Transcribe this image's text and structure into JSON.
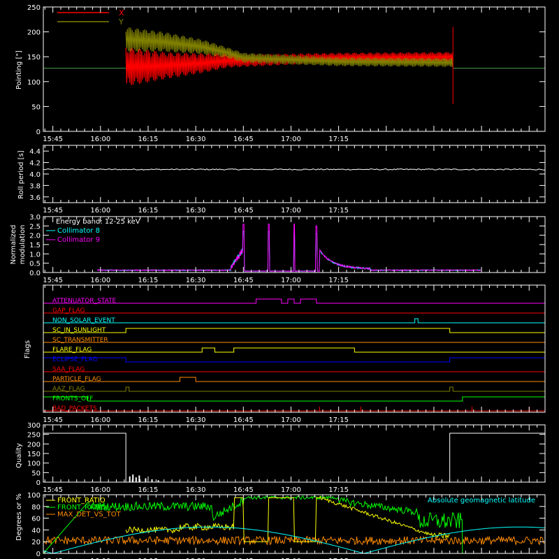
{
  "figure": {
    "background": "#000000",
    "foreground": "#ffffff"
  },
  "time_axis": {
    "ticks": [
      "15:45",
      "16:00",
      "16:15",
      "16:30",
      "16:45",
      "17:00",
      "17:15"
    ],
    "range_minutes": [
      -63,
      95
    ]
  },
  "chart_data": [
    {
      "type": "line",
      "ylabel": "Pointing [\"]",
      "ylim": [
        0,
        250
      ],
      "yticks": [
        0,
        50,
        100,
        150,
        200,
        250
      ],
      "legend": "top-left",
      "series": [
        {
          "name": "X",
          "color": "#ff0000",
          "center": [
            [
              -37,
              130
            ],
            [
              -25,
              132
            ],
            [
              -13,
              137
            ],
            [
              -5,
              142
            ],
            [
              0,
              142
            ],
            [
              30,
              148
            ],
            [
              75,
              150
            ]
          ],
          "amplitude": [
            [
              -37,
              80
            ],
            [
              -25,
              55
            ],
            [
              -13,
              40
            ],
            [
              -5,
              28
            ],
            [
              0,
              25
            ],
            [
              30,
              20
            ],
            [
              75,
              20
            ]
          ]
        },
        {
          "name": "Y",
          "color": "#808000",
          "center": [
            [
              -37,
              185
            ],
            [
              -25,
              180
            ],
            [
              -13,
              170
            ],
            [
              -5,
              158
            ],
            [
              0,
              148
            ],
            [
              30,
              140
            ],
            [
              75,
              138
            ]
          ],
          "amplitude": [
            [
              -37,
              50
            ],
            [
              -25,
              40
            ],
            [
              -13,
              30
            ],
            [
              -5,
              22
            ],
            [
              0,
              20
            ],
            [
              30,
              18
            ],
            [
              75,
              18
            ]
          ]
        }
      ],
      "baseline": 127
    },
    {
      "type": "line",
      "ylabel": "Roll period [s]",
      "ylim": [
        3.5,
        4.5
      ],
      "yticks": [
        3.6,
        3.8,
        4.0,
        4.2,
        4.4
      ],
      "series": [
        {
          "color": "#ffffff",
          "value": 4.08
        }
      ]
    },
    {
      "type": "line",
      "ylabel": "Normalized modulation",
      "ylim": [
        0,
        3.0
      ],
      "yticks": [
        0.0,
        0.5,
        1.0,
        1.5,
        2.0,
        2.5,
        3.0
      ],
      "legend": "top-left",
      "legend_title": "Energy band: 12-25 keV",
      "series": [
        {
          "name": "Collimator 8",
          "color": "#00ffff"
        },
        {
          "name": "Collimator 9",
          "color": "#ff00ff"
        }
      ],
      "spikes": [
        [
          0,
          2.5
        ],
        [
          8,
          2.5
        ],
        [
          16,
          2.5
        ],
        [
          23,
          2.4
        ]
      ],
      "active_range": [
        -46,
        75
      ]
    },
    {
      "type": "line",
      "ylabel": "Flags",
      "flags": [
        {
          "name": "ATTENUATOR_STATE",
          "color": "#ff00ff",
          "on": [
            [
              4,
              12
            ],
            [
              14,
              16
            ],
            [
              18,
              23
            ]
          ]
        },
        {
          "name": "GAP_FLAG",
          "color": "#ff0000",
          "on": []
        },
        {
          "name": "NON_SOLAR_EVENT",
          "color": "#00ffff",
          "on": [
            [
              54,
              55
            ]
          ]
        },
        {
          "name": "SC_IN_SUNLIGHT",
          "color": "#ffff00",
          "on": [
            [
              -37,
              65
            ]
          ]
        },
        {
          "name": "SC_TRANSMITTER",
          "color": "#ff8c00",
          "on": []
        },
        {
          "name": "FLARE_FLAG",
          "color": "#ffff00",
          "on": [
            [
              -13,
              -9
            ],
            [
              -3,
              35
            ]
          ]
        },
        {
          "name": "ECLIPSE_FLAG",
          "color": "#0000ff",
          "on": [
            [
              -100,
              -37
            ],
            [
              65,
              100
            ]
          ]
        },
        {
          "name": "SAA_FLAG",
          "color": "#ff0000",
          "on": []
        },
        {
          "name": "PARTICLE_FLAG",
          "color": "#ff8c00",
          "on": [
            [
              -20,
              -15
            ]
          ]
        },
        {
          "name": "AAZ_FLAG",
          "color": "#808000",
          "on": [
            [
              -37,
              -36
            ],
            [
              65,
              66
            ]
          ]
        },
        {
          "name": "FRONTS_OFF",
          "color": "#00ff00",
          "on": [
            [
              -100,
              -49
            ],
            [
              69,
              100
            ]
          ]
        },
        {
          "name": "BAD_PACKETS",
          "color": "#ff0000",
          "ticks": [
            24,
            37,
            72,
            90
          ]
        }
      ]
    },
    {
      "type": "line",
      "ylabel": "Quality",
      "ylim": [
        0,
        300
      ],
      "yticks": [
        0,
        50,
        100,
        150,
        200,
        250,
        300
      ],
      "series": [
        {
          "color": "#ffffff",
          "high": 256,
          "low_range": [
            -37,
            65
          ]
        }
      ]
    },
    {
      "type": "line",
      "ylabel": "Degrees or %",
      "ylim": [
        0,
        100
      ],
      "yticks": [
        0,
        20,
        40,
        60,
        80,
        100
      ],
      "legend": "top-left",
      "annotation": "Absolute geomagnetic latitude",
      "series": [
        {
          "name": "FRONT_RATIO",
          "color": "#ffff00"
        },
        {
          "name": "FRONT_RATIO",
          "color": "#00ff00"
        },
        {
          "name": "MAX_DET_VS_TOT",
          "color": "#ff8c00"
        },
        {
          "name": "",
          "color": "#00ffff"
        }
      ]
    }
  ]
}
